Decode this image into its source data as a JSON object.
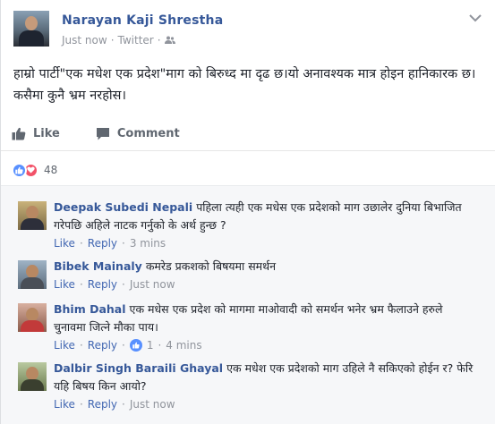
{
  "post": {
    "author": "Narayan Kaji  Shrestha",
    "time": "Just now",
    "source": "Twitter",
    "text": "हाम्रो पार्टी\"एक मधेश एक प्रदेश\"माग को बिरुध्द मा दृढ छ।यो अनावश्यक मात्र होइन हानिकारक छ।कसैमा कुनै भ्रम नरहोस।",
    "icons": {
      "audience": "friends-icon",
      "menu": "chevron-down-icon"
    }
  },
  "actions": {
    "like_label": "Like",
    "comment_label": "Comment"
  },
  "reactions": {
    "count": "48",
    "types": [
      "like",
      "love"
    ],
    "like_color": "#5890ff",
    "love_color": "#f25268"
  },
  "colors": {
    "link": "#365899",
    "meta": "#90949c",
    "action_link": "#4267b2"
  },
  "comments": [
    {
      "name": "Deepak Subedi Nepali",
      "text": "पहिला त्यही एक मधेस एक प्रदेशको माग उछालेर दुनिया बिभाजित गरेपछि अहिले नाटक गर्नुको के अर्थ हुन्छ ?",
      "like": "Like",
      "reply": "Reply",
      "time": "3 mins"
    },
    {
      "name": "Bibek Mainaly",
      "text": "कमरेड प्रकशको बिषयमा समर्थन",
      "like": "Like",
      "reply": "Reply",
      "time": "Just now"
    },
    {
      "name": "Bhim Dahal",
      "text": "एक मधेस एक प्रदेश को मागमा माओवादी को समर्थन भनेर भ्रम फैलाउने हरुले चुनावमा जित्ने मौका पाय।",
      "like": "Like",
      "reply": "Reply",
      "likes": "1",
      "time": "4 mins"
    },
    {
      "name": "Dalbir Singh Baraili Ghayal",
      "text": "एक मधेश एक प्रदेशको माग उहिले नै सकिएको होईन र? फेरि यहि बिषय किन आयो?",
      "like": "Like",
      "reply": "Reply",
      "time": "Just now"
    }
  ]
}
